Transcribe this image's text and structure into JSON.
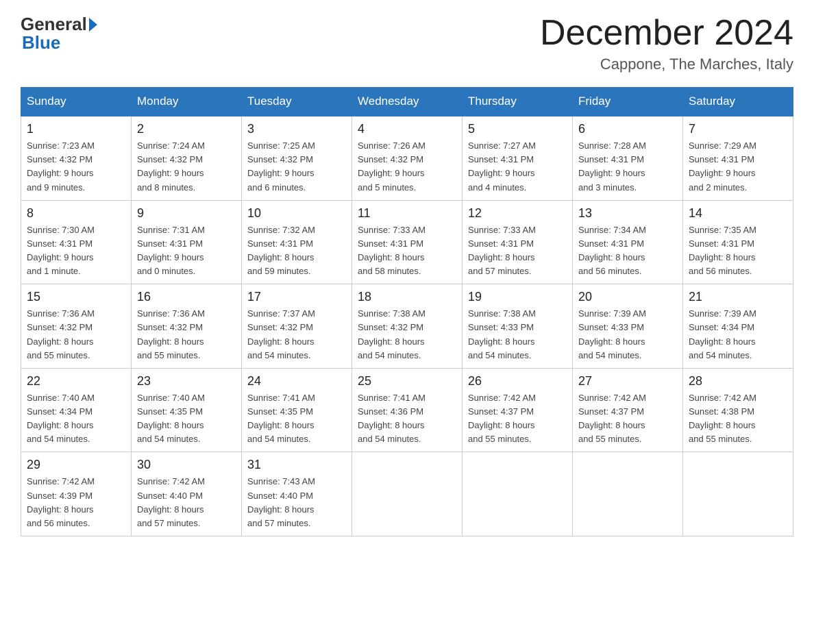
{
  "logo": {
    "general": "General",
    "blue": "Blue"
  },
  "header": {
    "month": "December 2024",
    "location": "Cappone, The Marches, Italy"
  },
  "days_of_week": [
    "Sunday",
    "Monday",
    "Tuesday",
    "Wednesday",
    "Thursday",
    "Friday",
    "Saturday"
  ],
  "weeks": [
    [
      {
        "num": "1",
        "info": "Sunrise: 7:23 AM\nSunset: 4:32 PM\nDaylight: 9 hours\nand 9 minutes."
      },
      {
        "num": "2",
        "info": "Sunrise: 7:24 AM\nSunset: 4:32 PM\nDaylight: 9 hours\nand 8 minutes."
      },
      {
        "num": "3",
        "info": "Sunrise: 7:25 AM\nSunset: 4:32 PM\nDaylight: 9 hours\nand 6 minutes."
      },
      {
        "num": "4",
        "info": "Sunrise: 7:26 AM\nSunset: 4:32 PM\nDaylight: 9 hours\nand 5 minutes."
      },
      {
        "num": "5",
        "info": "Sunrise: 7:27 AM\nSunset: 4:31 PM\nDaylight: 9 hours\nand 4 minutes."
      },
      {
        "num": "6",
        "info": "Sunrise: 7:28 AM\nSunset: 4:31 PM\nDaylight: 9 hours\nand 3 minutes."
      },
      {
        "num": "7",
        "info": "Sunrise: 7:29 AM\nSunset: 4:31 PM\nDaylight: 9 hours\nand 2 minutes."
      }
    ],
    [
      {
        "num": "8",
        "info": "Sunrise: 7:30 AM\nSunset: 4:31 PM\nDaylight: 9 hours\nand 1 minute."
      },
      {
        "num": "9",
        "info": "Sunrise: 7:31 AM\nSunset: 4:31 PM\nDaylight: 9 hours\nand 0 minutes."
      },
      {
        "num": "10",
        "info": "Sunrise: 7:32 AM\nSunset: 4:31 PM\nDaylight: 8 hours\nand 59 minutes."
      },
      {
        "num": "11",
        "info": "Sunrise: 7:33 AM\nSunset: 4:31 PM\nDaylight: 8 hours\nand 58 minutes."
      },
      {
        "num": "12",
        "info": "Sunrise: 7:33 AM\nSunset: 4:31 PM\nDaylight: 8 hours\nand 57 minutes."
      },
      {
        "num": "13",
        "info": "Sunrise: 7:34 AM\nSunset: 4:31 PM\nDaylight: 8 hours\nand 56 minutes."
      },
      {
        "num": "14",
        "info": "Sunrise: 7:35 AM\nSunset: 4:31 PM\nDaylight: 8 hours\nand 56 minutes."
      }
    ],
    [
      {
        "num": "15",
        "info": "Sunrise: 7:36 AM\nSunset: 4:32 PM\nDaylight: 8 hours\nand 55 minutes."
      },
      {
        "num": "16",
        "info": "Sunrise: 7:36 AM\nSunset: 4:32 PM\nDaylight: 8 hours\nand 55 minutes."
      },
      {
        "num": "17",
        "info": "Sunrise: 7:37 AM\nSunset: 4:32 PM\nDaylight: 8 hours\nand 54 minutes."
      },
      {
        "num": "18",
        "info": "Sunrise: 7:38 AM\nSunset: 4:32 PM\nDaylight: 8 hours\nand 54 minutes."
      },
      {
        "num": "19",
        "info": "Sunrise: 7:38 AM\nSunset: 4:33 PM\nDaylight: 8 hours\nand 54 minutes."
      },
      {
        "num": "20",
        "info": "Sunrise: 7:39 AM\nSunset: 4:33 PM\nDaylight: 8 hours\nand 54 minutes."
      },
      {
        "num": "21",
        "info": "Sunrise: 7:39 AM\nSunset: 4:34 PM\nDaylight: 8 hours\nand 54 minutes."
      }
    ],
    [
      {
        "num": "22",
        "info": "Sunrise: 7:40 AM\nSunset: 4:34 PM\nDaylight: 8 hours\nand 54 minutes."
      },
      {
        "num": "23",
        "info": "Sunrise: 7:40 AM\nSunset: 4:35 PM\nDaylight: 8 hours\nand 54 minutes."
      },
      {
        "num": "24",
        "info": "Sunrise: 7:41 AM\nSunset: 4:35 PM\nDaylight: 8 hours\nand 54 minutes."
      },
      {
        "num": "25",
        "info": "Sunrise: 7:41 AM\nSunset: 4:36 PM\nDaylight: 8 hours\nand 54 minutes."
      },
      {
        "num": "26",
        "info": "Sunrise: 7:42 AM\nSunset: 4:37 PM\nDaylight: 8 hours\nand 55 minutes."
      },
      {
        "num": "27",
        "info": "Sunrise: 7:42 AM\nSunset: 4:37 PM\nDaylight: 8 hours\nand 55 minutes."
      },
      {
        "num": "28",
        "info": "Sunrise: 7:42 AM\nSunset: 4:38 PM\nDaylight: 8 hours\nand 55 minutes."
      }
    ],
    [
      {
        "num": "29",
        "info": "Sunrise: 7:42 AM\nSunset: 4:39 PM\nDaylight: 8 hours\nand 56 minutes."
      },
      {
        "num": "30",
        "info": "Sunrise: 7:42 AM\nSunset: 4:40 PM\nDaylight: 8 hours\nand 57 minutes."
      },
      {
        "num": "31",
        "info": "Sunrise: 7:43 AM\nSunset: 4:40 PM\nDaylight: 8 hours\nand 57 minutes."
      },
      {
        "num": "",
        "info": ""
      },
      {
        "num": "",
        "info": ""
      },
      {
        "num": "",
        "info": ""
      },
      {
        "num": "",
        "info": ""
      }
    ]
  ]
}
